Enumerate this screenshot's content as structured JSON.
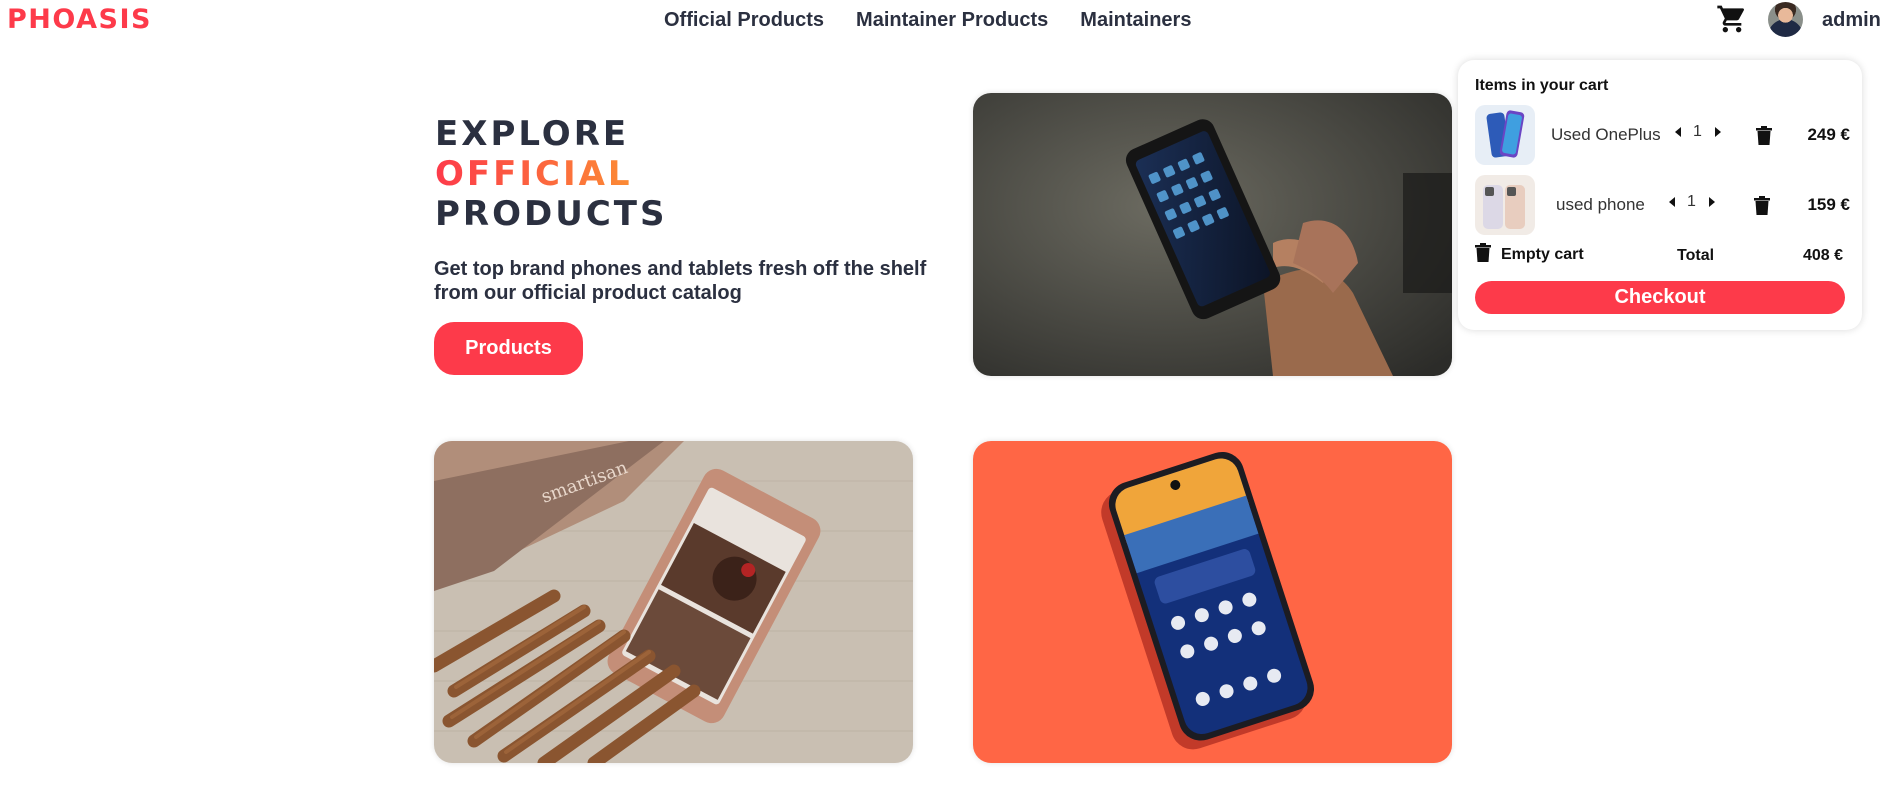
{
  "brand": {
    "logo": "PHOASIS",
    "accent_color": "#fd3a4a"
  },
  "nav": {
    "items": [
      {
        "label": "Official Products"
      },
      {
        "label": "Maintainer Products"
      },
      {
        "label": "Maintainers"
      }
    ]
  },
  "header": {
    "cart_icon": "cart-icon",
    "user_name": "admin"
  },
  "hero": {
    "title_line1": "EXPLORE",
    "title_line2": "OFFICIAL",
    "title_line3": "PRODUCTS",
    "subtitle": "Get top brand phones and tablets fresh off the shelf from our official product catalog",
    "button_label": "Products"
  },
  "cards": [
    {
      "image": "hand-holding-rugged-phone-photo"
    },
    {
      "image": "rose-gold-phone-with-chocolate-sticks-photo",
      "visible_text": "smartisan"
    },
    {
      "image": "phone-on-orange-background-photo",
      "accent": "#ff6645"
    }
  ],
  "cart": {
    "title": "Items in your cart",
    "items": [
      {
        "name": "Used OnePlus",
        "quantity": "1",
        "price": "249 €"
      },
      {
        "name": "used phone",
        "quantity": "1",
        "price": "159 €"
      }
    ],
    "empty_label": "Empty cart",
    "total_label": "Total",
    "total_value": "408 €",
    "checkout_label": "Checkout"
  }
}
